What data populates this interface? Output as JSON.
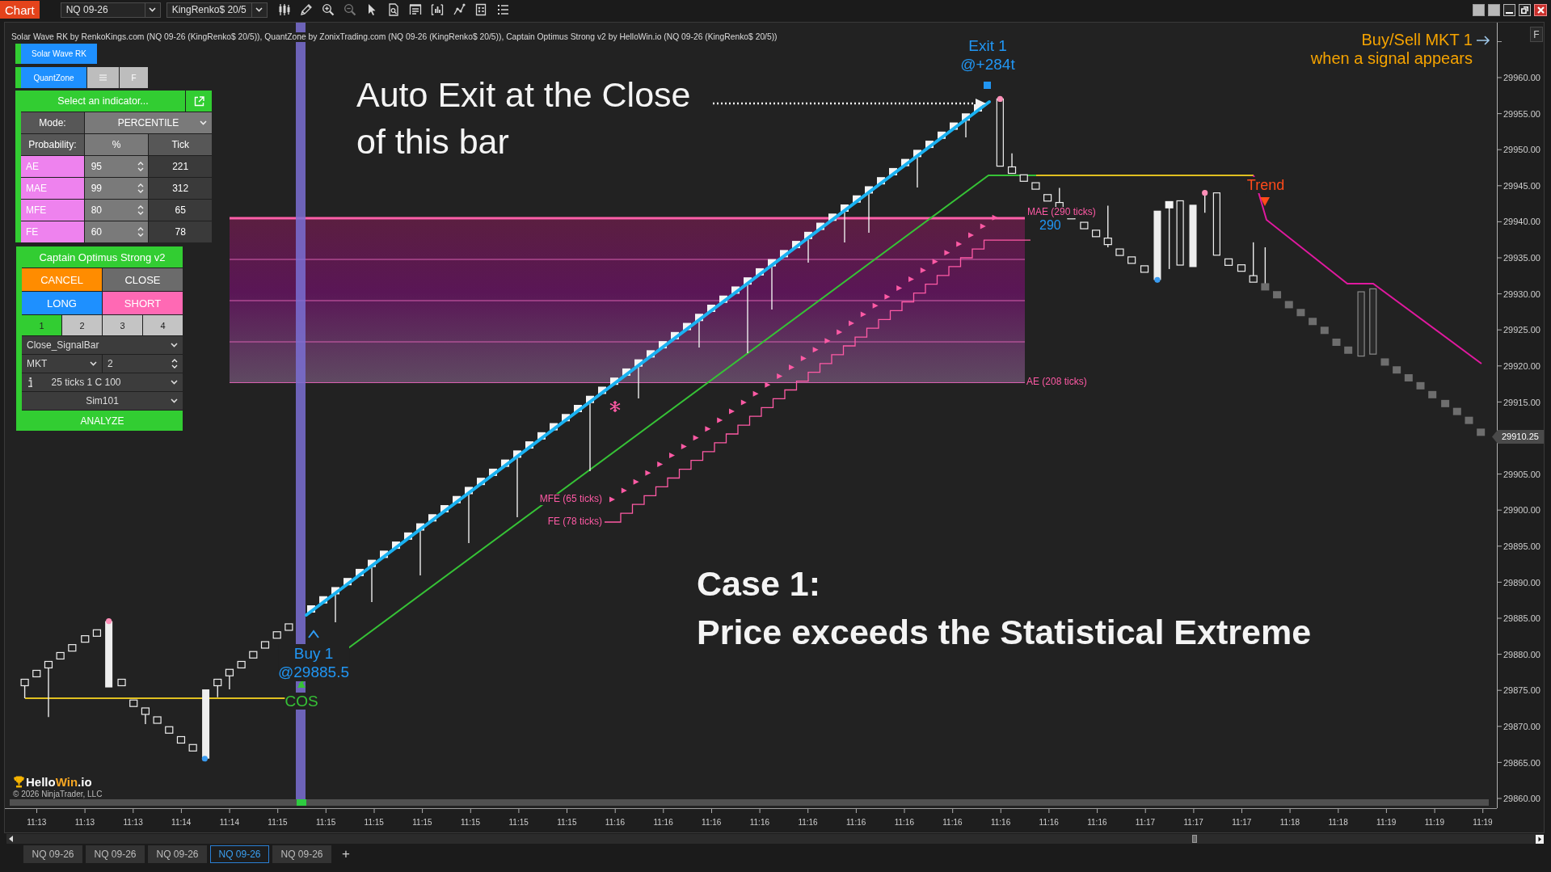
{
  "toolbar": {
    "app_tab": "Chart",
    "instrument": "NQ 09-26",
    "bar_type": "KingRenko$ 20/5"
  },
  "legend": "Solar Wave RK by RenkoKings.com (NQ 09-26 (KingRenko$ 20/5)), QuantZone by ZonixTrading.com (NQ 09-26 (KingRenko$ 20/5)), Captain Optimus Strong v2 by HelloWin.io (NQ 09-26 (KingRenko$ 20/5))",
  "chart_button": "F",
  "solar_wave_button": "Solar Wave RK",
  "quantzone": {
    "button": "QuantZone",
    "option_button": "F",
    "select": "Select an indicator...",
    "mode_label": "Mode:",
    "mode": "PERCENTILE",
    "columns": [
      "Probability:",
      "%",
      "Tick"
    ],
    "rows": [
      {
        "name": "AE",
        "percent": "95",
        "ticks": "221"
      },
      {
        "name": "MAE",
        "percent": "99",
        "ticks": "312"
      },
      {
        "name": "MFE",
        "percent": "80",
        "ticks": "65"
      },
      {
        "name": "FE",
        "percent": "60",
        "ticks": "78"
      }
    ]
  },
  "captain": {
    "title": "Captain Optimus Strong v2",
    "actions": [
      {
        "label": "CANCEL",
        "kind": "cancel"
      },
      {
        "label": "CLOSE",
        "kind": "close"
      },
      {
        "label": "LONG",
        "kind": "long"
      },
      {
        "label": "SHORT",
        "kind": "short"
      }
    ],
    "slots": [
      {
        "label": "1",
        "selected": true
      },
      {
        "label": "2",
        "selected": false
      },
      {
        "label": "3",
        "selected": false
      },
      {
        "label": "4",
        "selected": false
      }
    ],
    "exit_mode": "Close_SignalBar",
    "order_type": "MKT",
    "quantity": "2",
    "template": "25 ticks 1 C 100",
    "account": "Sim101",
    "analyze": "ANALYZE"
  },
  "annotations": {
    "callout": [
      "Auto Exit at the Close",
      "of this bar"
    ],
    "exit": [
      "Exit 1",
      "@+284t"
    ],
    "signal_note": [
      "Buy/Sell MKT 1",
      "when a signal appears"
    ],
    "trend": "Trend",
    "mae": "MAE (290 ticks)",
    "mae_value": "290",
    "ae": "AE (208 ticks)",
    "mfe": "MFE (65 ticks)",
    "fe": "FE (78 ticks)",
    "entry": [
      "Buy 1",
      "@29885.5"
    ],
    "cos": "COS",
    "case_title": "Case 1:",
    "case_text": "Price exceeds the Statistical Extreme"
  },
  "logo": [
    {
      "text": "Hello",
      "kind": "plain"
    },
    {
      "text": "Win",
      "kind": "accent"
    },
    {
      "text": ".io",
      "kind": "plain"
    }
  ],
  "copyright": "© 2026 NinjaTrader, LLC",
  "price_axis": {
    "labels": [
      "29960.00",
      "29955.00",
      "29950.00",
      "29945.00",
      "29940.00",
      "29935.00",
      "29930.00",
      "29925.00",
      "29920.00",
      "29915.00",
      "29905.00",
      "29900.00",
      "29895.00",
      "29890.00",
      "29885.00",
      "29880.00",
      "29875.00",
      "29870.00",
      "29865.00",
      "29860.00"
    ],
    "last_price": "29910.25"
  },
  "time_axis": {
    "labels": [
      "11:13",
      "11:13",
      "11:13",
      "11:14",
      "11:14",
      "11:15",
      "11:15",
      "11:15",
      "11:15",
      "11:15",
      "11:15",
      "11:15",
      "11:16",
      "11:16",
      "11:16",
      "11:16",
      "11:16",
      "11:16",
      "11:16",
      "11:16",
      "11:16",
      "11:16",
      "11:16",
      "11:17",
      "11:17",
      "11:17",
      "11:18",
      "11:18",
      "11:19",
      "11:19",
      "11:19"
    ]
  },
  "tabs": [
    {
      "label": "NQ 09-26",
      "selected": false
    },
    {
      "label": "NQ 09-26",
      "selected": false
    },
    {
      "label": "NQ 09-26",
      "selected": false
    },
    {
      "label": "NQ 09-26",
      "selected": true
    },
    {
      "label": "NQ 09-26",
      "selected": false
    }
  ],
  "add_tab": "+"
}
